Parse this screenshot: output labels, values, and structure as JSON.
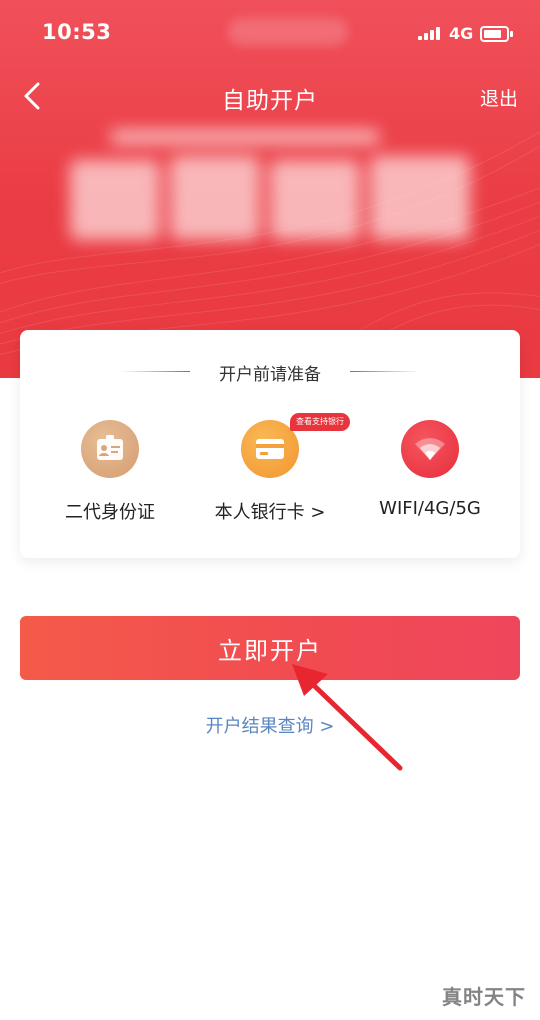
{
  "status_bar": {
    "time": "10:53",
    "network": "4G"
  },
  "nav": {
    "title": "自助开户",
    "exit_label": "退出"
  },
  "prep_card": {
    "heading": "开户前请准备",
    "items": [
      {
        "label": "二代身份证",
        "icon": "id-card-icon",
        "color": "#d9a57a"
      },
      {
        "label": "本人银行卡 >",
        "icon": "bank-card-icon",
        "color": "#f5a03c",
        "badge": "查看支持银行"
      },
      {
        "label": "WIFI/4G/5G",
        "icon": "wifi-icon",
        "color": "#ee3a46"
      }
    ]
  },
  "actions": {
    "open_account_label": "立即开户",
    "query_result_label": "开户结果查询 >"
  },
  "watermark": "真时天下",
  "colors": {
    "brand_red": "#ea3c44",
    "button_red": "#f14b52",
    "link_blue": "#5a86bf"
  }
}
